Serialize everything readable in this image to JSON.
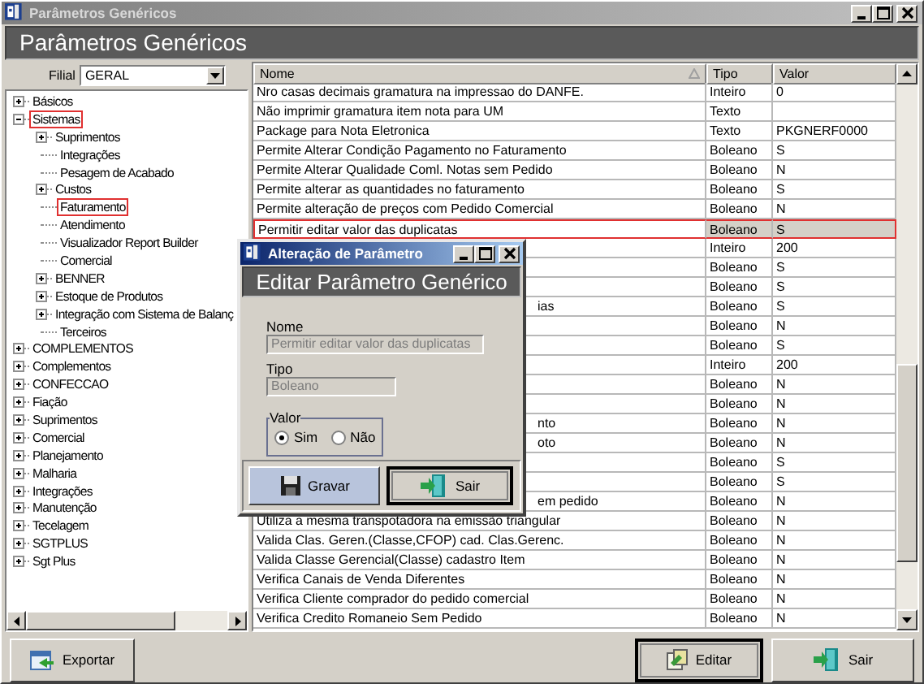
{
  "window": {
    "title": "Parâmetros Genéricos"
  },
  "header": "Parâmetros Genéricos",
  "filter": {
    "label": "Filial",
    "value": "GERAL"
  },
  "tree": [
    {
      "label": "Básicos",
      "expanded": false,
      "highlighted": false
    },
    {
      "label": "Sistemas",
      "expanded": true,
      "highlighted": true,
      "children": [
        {
          "label": "Suprimentos",
          "expanded": false,
          "highlighted": false
        },
        {
          "label": "Integrações",
          "highlighted": false
        },
        {
          "label": "Pesagem de Acabado",
          "highlighted": false
        },
        {
          "label": "Custos",
          "expanded": false,
          "highlighted": false
        },
        {
          "label": "Faturamento",
          "highlighted": true
        },
        {
          "label": "Atendimento",
          "highlighted": false
        },
        {
          "label": "Visualizador Report Builder",
          "highlighted": false
        },
        {
          "label": "Comercial",
          "highlighted": false
        },
        {
          "label": "BENNER",
          "expanded": false,
          "highlighted": false
        },
        {
          "label": "Estoque de Produtos",
          "expanded": false,
          "highlighted": false
        },
        {
          "label": "Integração com Sistema de Balanç",
          "expanded": false,
          "highlighted": false
        },
        {
          "label": "Terceiros",
          "highlighted": false
        }
      ]
    },
    {
      "label": "COMPLEMENTOS",
      "expanded": false,
      "highlighted": false
    },
    {
      "label": "Complementos",
      "expanded": false,
      "highlighted": false
    },
    {
      "label": "CONFECCAO",
      "expanded": false,
      "highlighted": false
    },
    {
      "label": "Fiação",
      "expanded": false,
      "highlighted": false
    },
    {
      "label": "Suprimentos",
      "expanded": false,
      "highlighted": false
    },
    {
      "label": "Comercial",
      "expanded": false,
      "highlighted": false
    },
    {
      "label": "Planejamento",
      "expanded": false,
      "highlighted": false
    },
    {
      "label": "Malharia",
      "expanded": false,
      "highlighted": false
    },
    {
      "label": "Integrações",
      "expanded": false,
      "highlighted": false
    },
    {
      "label": "Manutenção",
      "expanded": false,
      "highlighted": false
    },
    {
      "label": "Tecelagem",
      "expanded": false,
      "highlighted": false
    },
    {
      "label": "SGTPLUS",
      "expanded": false,
      "highlighted": false
    },
    {
      "label": "Sgt Plus",
      "expanded": false,
      "highlighted": false
    }
  ],
  "table": {
    "columns": [
      {
        "label": "Nome",
        "sorted": true
      },
      {
        "label": "Tipo",
        "sorted": false
      },
      {
        "label": "Valor",
        "sorted": false
      }
    ],
    "rows": [
      {
        "name": "Nro casas decimais gramatura na impressao do DANFE.",
        "type": "Inteiro",
        "value": "0",
        "selected": false
      },
      {
        "name": "Não imprimir gramatura item nota para UM",
        "type": "Texto",
        "selected": false
      },
      {
        "name": "Package para Nota Eletronica",
        "type": "Texto",
        "value": "PKGNERF0000",
        "selected": false
      },
      {
        "name": "Permite Alterar Condição Pagamento no Faturamento",
        "type": "Boleano",
        "value": "S",
        "selected": false
      },
      {
        "name": "Permite Alterar Qualidade Coml. Notas sem Pedido",
        "type": "Boleano",
        "value": "N",
        "selected": false
      },
      {
        "name": "Permite alterar as quantidades no faturamento",
        "type": "Boleano",
        "value": "S",
        "selected": false
      },
      {
        "name": "Permite alteração de preços com Pedido Comercial",
        "type": "Boleano",
        "value": "N",
        "selected": false
      },
      {
        "name": "Permitir editar valor das duplicatas",
        "type": "Boleano",
        "value": "S",
        "selected": true
      },
      {
        "type": "Inteiro",
        "value": "200",
        "selected": false
      },
      {
        "type": "Boleano",
        "value": "S",
        "selected": false
      },
      {
        "type": "Boleano",
        "value": "S",
        "selected": false
      },
      {
        "name_tail": "ias",
        "type": "Boleano",
        "value": "S",
        "selected": false
      },
      {
        "type": "Boleano",
        "value": "N",
        "selected": false
      },
      {
        "type": "Boleano",
        "value": "S",
        "selected": false
      },
      {
        "type": "Inteiro",
        "value": "200",
        "selected": false
      },
      {
        "type": "Boleano",
        "value": "N",
        "selected": false
      },
      {
        "type": "Boleano",
        "value": "N",
        "selected": false
      },
      {
        "name_tail": "nto",
        "type": "Boleano",
        "value": "N",
        "selected": false
      },
      {
        "name_tail": "oto",
        "type": "Boleano",
        "value": "N",
        "selected": false
      },
      {
        "type": "Boleano",
        "value": "S",
        "selected": false
      },
      {
        "type": "Boleano",
        "value": "S",
        "selected": false
      },
      {
        "name_tail": "em pedido",
        "type": "Boleano",
        "value": "N",
        "selected": false
      },
      {
        "name": "Utiliza a mesma transpotadora na emissão triangular",
        "type": "Boleano",
        "value": "N",
        "selected": false
      },
      {
        "name": "Valida Clas. Geren.(Classe,CFOP) cad. Clas.Gerenc.",
        "type": "Boleano",
        "value": "N",
        "selected": false
      },
      {
        "name": "Valida Classe Gerencial(Classe) cadastro Item",
        "type": "Boleano",
        "value": "N",
        "selected": false
      },
      {
        "name": "Verifica Canais de Venda Diferentes",
        "type": "Boleano",
        "value": "N",
        "selected": false
      },
      {
        "name": "Verifica Cliente comprador do pedido comercial",
        "type": "Boleano",
        "value": "N",
        "selected": false
      },
      {
        "name": "Verifica Credito Romaneio Sem Pedido",
        "type": "Boleano",
        "value": "N",
        "selected": false
      }
    ]
  },
  "dialog": {
    "title": "Alteração de Parâmetro",
    "header": "Editar Parâmetro Genérico",
    "fields": [
      {
        "label": "Nome",
        "value": "Permitir editar valor das duplicatas"
      },
      {
        "label": "Tipo",
        "value": "Boleano"
      }
    ],
    "value_group": {
      "label": "Valor",
      "options": [
        {
          "label": "Sim",
          "selected": true
        },
        {
          "label": "Não",
          "selected": false
        }
      ]
    },
    "buttons": [
      {
        "label": "Gravar",
        "kind": "save",
        "focused": false,
        "hovered": true
      },
      {
        "label": "Sair",
        "kind": "exit",
        "focused": true,
        "hovered": false
      }
    ]
  },
  "buttons": [
    {
      "label": "Exportar",
      "kind": "export",
      "focused": false,
      "hovered": false
    },
    {
      "label": "Editar",
      "kind": "edit",
      "focused": true,
      "hovered": false
    },
    {
      "label": "Sair",
      "kind": "exit",
      "focused": false,
      "hovered": false
    }
  ]
}
